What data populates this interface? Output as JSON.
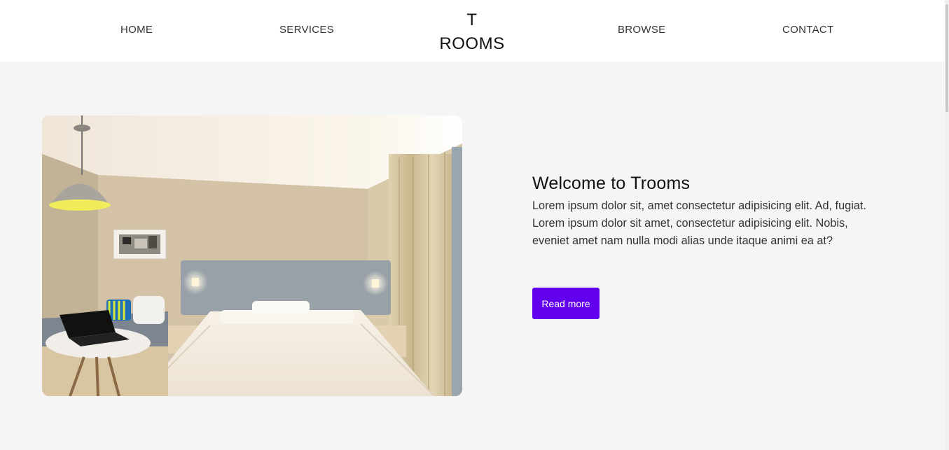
{
  "nav": {
    "links": [
      "HOME",
      "SERVICES",
      "BROWSE",
      "CONTACT"
    ],
    "logo_top": "T",
    "logo_bottom": "ROOMS"
  },
  "hero": {
    "image_icon": "hotel-room-photo",
    "title": "Welcome to Trooms",
    "body": "Lorem ipsum dolor sit, amet consectetur adipisicing elit. Ad, fugiat. Lorem ipsum dolor sit amet, consectetur adipisicing elit. Nobis, eveniet amet nam nulla modi alias unde itaque animi ea at?",
    "button_label": "Read more"
  },
  "colors": {
    "background": "#f5f5f5",
    "nav_background": "#ffffff",
    "accent": "#6200ee"
  }
}
